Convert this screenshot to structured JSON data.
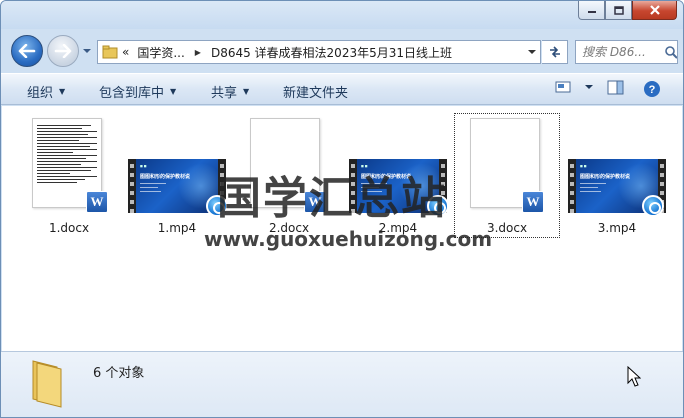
{
  "window": {
    "caption_buttons": [
      "minimize-icon",
      "maximize-icon",
      "close-icon"
    ]
  },
  "nav": {
    "address": {
      "overflow_marker": "«",
      "segments": [
        "国学资...",
        "D8645 详春成春相法2023年5月31日线上班"
      ]
    },
    "search": {
      "placeholder": "搜索 D86..."
    }
  },
  "toolbar": {
    "organize": "组织",
    "include_in_library": "包含到库中",
    "share": "共享",
    "new_folder": "新建文件夹"
  },
  "files": [
    {
      "name": "1.docx",
      "type": "docx",
      "has_text_preview": true
    },
    {
      "name": "1.mp4",
      "type": "mp4",
      "thumb_title": "图图和形的保护教材说"
    },
    {
      "name": "2.docx",
      "type": "docx",
      "has_text_preview": false
    },
    {
      "name": "2.mp4",
      "type": "mp4",
      "thumb_title": "图图和形的保护教材说"
    },
    {
      "name": "3.docx",
      "type": "docx",
      "has_text_preview": false,
      "focused": true
    },
    {
      "name": "3.mp4",
      "type": "mp4",
      "thumb_title": "图图和形的保护教材说"
    }
  ],
  "watermark": {
    "text": "国学汇总站",
    "url": "www.guoxuehuizong.com"
  },
  "details": {
    "item_count": "6 个对象"
  },
  "colors": {
    "window_frame": "#cfe0f2",
    "toolbar_text": "#1e395b",
    "video_blue": "#1b62c8",
    "word_blue": "#1d56a8"
  }
}
